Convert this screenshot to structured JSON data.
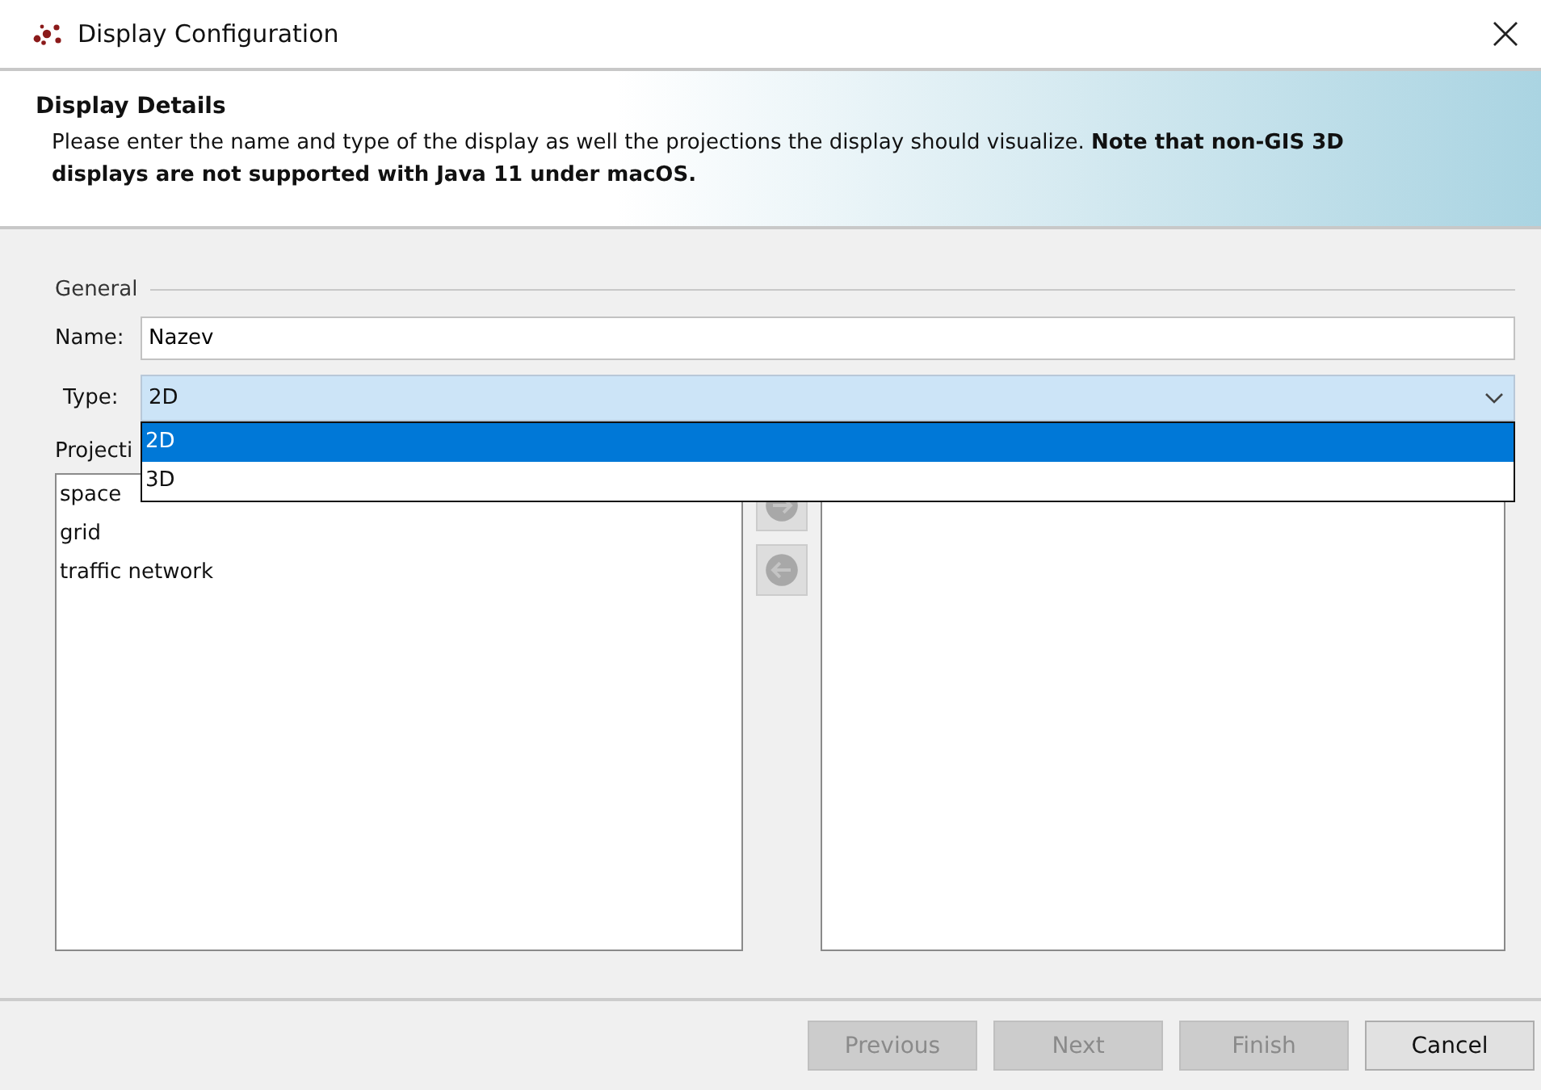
{
  "window": {
    "title": "Display Configuration"
  },
  "header": {
    "title": "Display Details",
    "description": "Please enter the name and type of the display as well the projections the display should visualize. **Note that non-GIS 3D displays are not supported with Java 11 under macOS.**"
  },
  "general": {
    "legend": "General",
    "name_label": "Name:",
    "name_value": "Nazev",
    "type_label": "Type:",
    "type_value": "2D",
    "type_expanded": true,
    "type_options": [
      {
        "label": "2D",
        "selected": true
      },
      {
        "label": "3D",
        "selected": false
      }
    ]
  },
  "projections": {
    "label": "Projecti",
    "available": [
      {
        "label": "space",
        "selected": false
      },
      {
        "label": "grid",
        "selected": false
      },
      {
        "label": "traffic network",
        "selected": false
      }
    ],
    "move_buttons": [
      {
        "kind": "add",
        "disabled": true
      },
      {
        "kind": "remove",
        "disabled": true
      }
    ]
  },
  "buttons": [
    {
      "label": "Previous",
      "disabled": true
    },
    {
      "label": "Next",
      "disabled": true
    },
    {
      "label": "Finish",
      "disabled": true
    },
    {
      "label": "Cancel",
      "disabled": false
    }
  ]
}
